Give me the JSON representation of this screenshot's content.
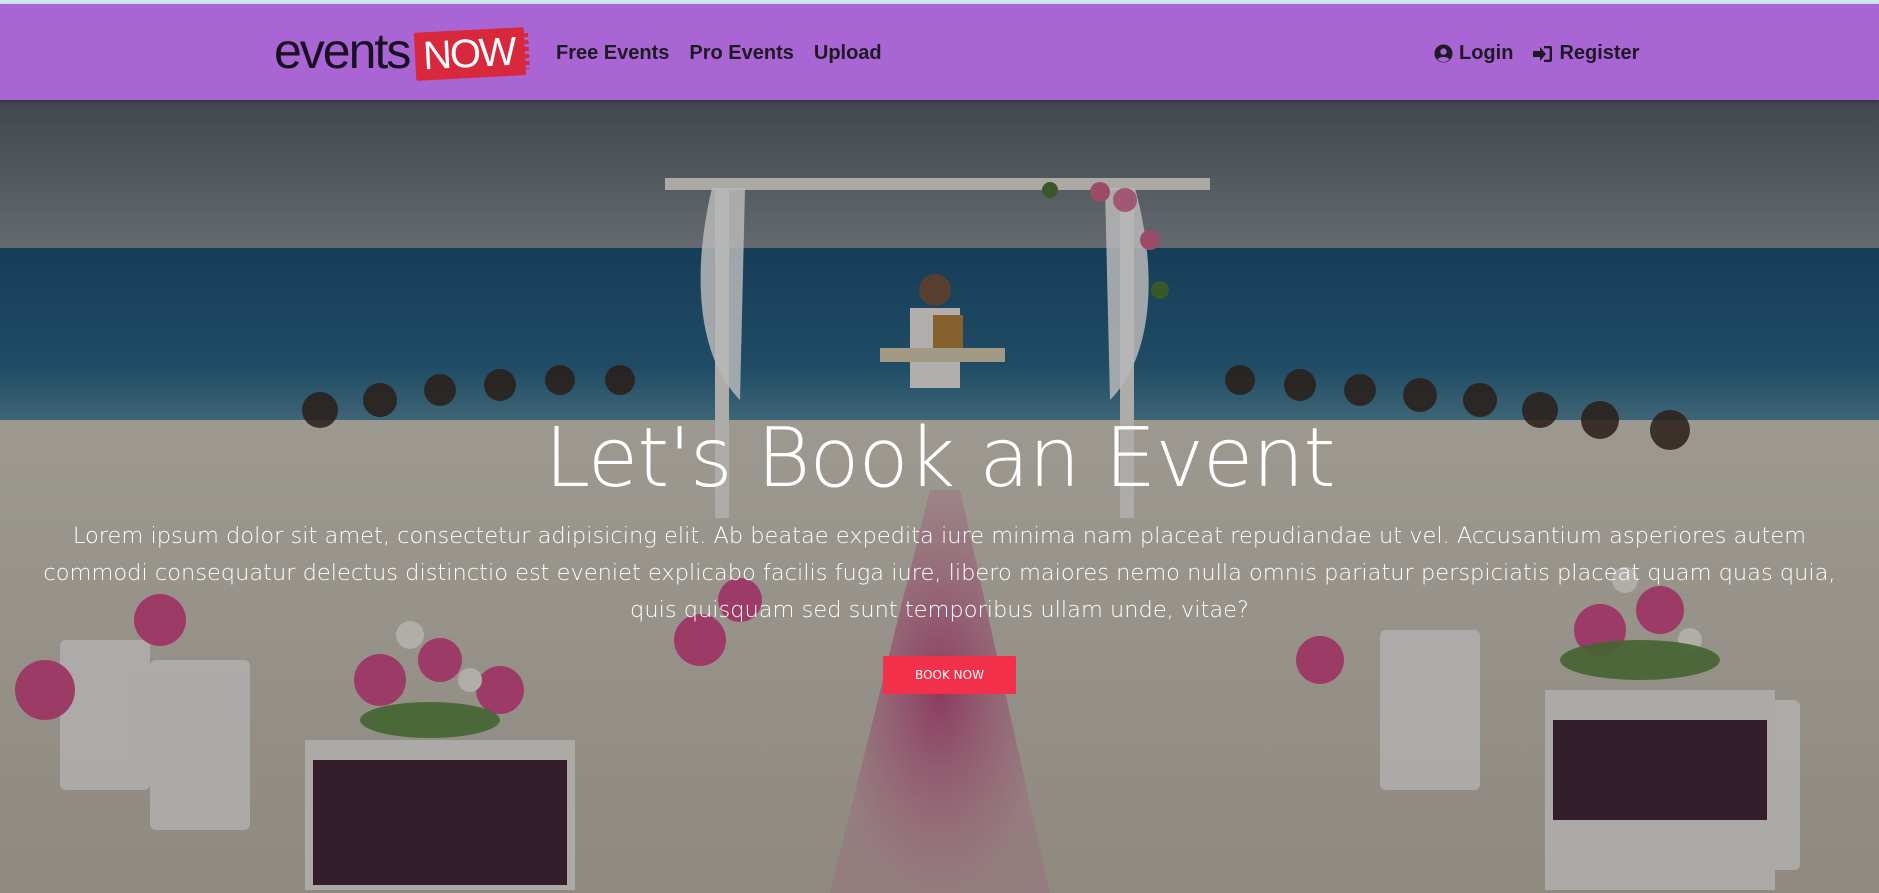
{
  "logo": {
    "word": "events",
    "ticket": "NOW"
  },
  "nav": {
    "links": [
      {
        "label": "Free Events"
      },
      {
        "label": "Pro Events"
      },
      {
        "label": "Upload"
      }
    ],
    "login": {
      "label": "Login",
      "icon": "user-circle-icon"
    },
    "register": {
      "label": "Register",
      "icon": "sign-in-icon"
    }
  },
  "hero": {
    "title": "Let's Book an Event",
    "text": "Lorem ipsum dolor sit amet, consectetur adipisicing elit. Ab beatae expedita iure minima nam placeat repudiandae ut vel. Accusantium asperiores autem commodi consequatur delectus distinctio est eveniet explicabo facilis fuga iure, libero maiores nemo nulla omnis pariatur perspiciatis placeat quam quas quia, quis quisquam sed sunt temporibus ullam unde, vitae?",
    "button": "BOOK NOW",
    "image_alt": "beach wedding ceremony photo"
  },
  "colors": {
    "navbar": "#a965d4",
    "button": "#f2304a",
    "logo_ticket": "#d8283c"
  }
}
